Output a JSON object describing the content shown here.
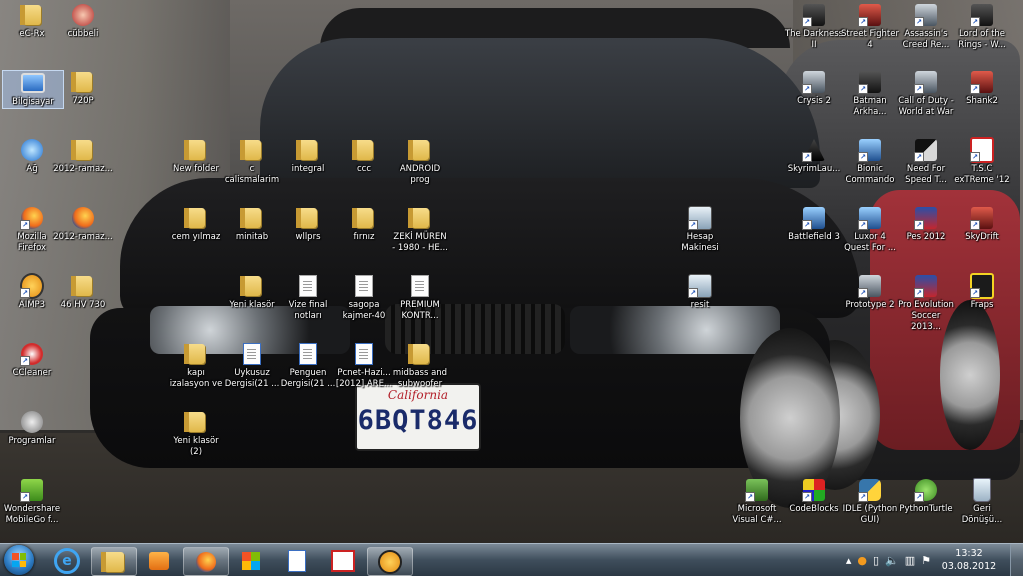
{
  "desktop": {
    "icons": [
      {
        "label": "eC-Rx",
        "type": "folder"
      },
      {
        "label": "cübbeli",
        "type": "app-red"
      },
      {
        "label": "Bilgisayar",
        "type": "computer"
      },
      {
        "label": "720P",
        "type": "folder"
      },
      {
        "label": "Ağ",
        "type": "network"
      },
      {
        "label": "2012-ramaz...",
        "type": "folder"
      },
      {
        "label": "Mozilla\nFirefox",
        "type": "firefox"
      },
      {
        "label": "2012-ramaz...",
        "type": "firefox-doc"
      },
      {
        "label": "AIMP3",
        "type": "aimp"
      },
      {
        "label": "46 HV 730",
        "type": "folder"
      },
      {
        "label": "CCleaner",
        "type": "ccleaner"
      },
      {
        "label": "Programlar",
        "type": "gear"
      },
      {
        "label": "Wondershare\nMobileGo f...",
        "type": "mobilego"
      },
      {
        "label": "New folder",
        "type": "folder"
      },
      {
        "label": "c\ncalismalarim",
        "type": "folder"
      },
      {
        "label": "integral",
        "type": "folder"
      },
      {
        "label": "ccc",
        "type": "folder"
      },
      {
        "label": "ANDROID\nprog",
        "type": "folder"
      },
      {
        "label": "cem yılmaz",
        "type": "folder"
      },
      {
        "label": "minitab",
        "type": "folder"
      },
      {
        "label": "wllprs",
        "type": "folder"
      },
      {
        "label": "fırnız",
        "type": "folder"
      },
      {
        "label": "ZEKİ MÜREN\n- 1980 - HE...",
        "type": "folder"
      },
      {
        "label": "Yeni klasör",
        "type": "folder"
      },
      {
        "label": "Vize final\nnotları",
        "type": "doc"
      },
      {
        "label": "sagopa\nkajmer-40",
        "type": "doc"
      },
      {
        "label": "PREMIUM\nKONTR...",
        "type": "doc"
      },
      {
        "label": "kapı\nizalasyon ve",
        "type": "folder"
      },
      {
        "label": "Uykusuz\nDergisi(21 ...",
        "type": "pdfdoc"
      },
      {
        "label": "Penguen\nDergisi(21 ...",
        "type": "pdfdoc"
      },
      {
        "label": "Pcnet-Hazi...\n[2012] ARE...",
        "type": "pdfdoc"
      },
      {
        "label": "midbass and\nsubwoofer",
        "type": "folder"
      },
      {
        "label": "Yeni klasör\n(2)",
        "type": "folder"
      },
      {
        "label": "Hesap\nMakinesi",
        "type": "calc"
      },
      {
        "label": "resit",
        "type": "calc"
      },
      {
        "label": "The Darkness\nII",
        "type": "game-dark"
      },
      {
        "label": "Street Fighter\n4",
        "type": "game-red"
      },
      {
        "label": "Assassin's\nCreed Re...",
        "type": "game-grey"
      },
      {
        "label": "Lord of the\nRings - W...",
        "type": "game-dark"
      },
      {
        "label": "Crysis 2",
        "type": "game-grey"
      },
      {
        "label": "Batman\nArkha...",
        "type": "game-dark"
      },
      {
        "label": "Call of Duty -\nWorld at War",
        "type": "game-grey"
      },
      {
        "label": "Shank2",
        "type": "game-red"
      },
      {
        "label": "SkyrimLau...",
        "type": "game-skyrim"
      },
      {
        "label": "Bionic\nCommando",
        "type": "game-blue"
      },
      {
        "label": "Need For\nSpeed T...",
        "type": "game-nfs"
      },
      {
        "label": "T.S.C\nexTReme '12",
        "type": "game-tsc"
      },
      {
        "label": "Battlefield 3",
        "type": "game-blue"
      },
      {
        "label": "Luxor 4\nQuest For ...",
        "type": "game-blue"
      },
      {
        "label": "Pes 2012",
        "type": "game-pes"
      },
      {
        "label": "SkyDrift",
        "type": "game-red"
      },
      {
        "label": "Prototype 2",
        "type": "game-grey"
      },
      {
        "label": "Pro Evolution\nSoccer 2013...",
        "type": "game-pes"
      },
      {
        "label": "Fraps",
        "type": "fraps"
      },
      {
        "label": "Microsoft\nVisual C#...",
        "type": "vs"
      },
      {
        "label": "CodeBlocks",
        "type": "codeblocks"
      },
      {
        "label": "IDLE (Python\nGUI)",
        "type": "python"
      },
      {
        "label": "PythonTurtle",
        "type": "turtle"
      },
      {
        "label": "Geri\nDönüşü...",
        "type": "recycle"
      }
    ],
    "plate": {
      "state": "California",
      "number": "6BQT846"
    }
  },
  "taskbar": {
    "pinned": [
      {
        "name": "internet-explorer",
        "active": false
      },
      {
        "name": "file-explorer",
        "active": true
      },
      {
        "name": "media-player",
        "active": false
      },
      {
        "name": "firefox",
        "active": true
      },
      {
        "name": "windows-app",
        "active": false
      },
      {
        "name": "file-app",
        "active": false
      },
      {
        "name": "tsc-extreme",
        "active": false
      },
      {
        "name": "aimp",
        "active": true
      }
    ],
    "tray": {
      "icons": [
        "chevron-up",
        "avast",
        "device",
        "speaker",
        "network",
        "flag"
      ]
    },
    "clock": {
      "time": "13:32",
      "date": "03.08.2012"
    }
  }
}
